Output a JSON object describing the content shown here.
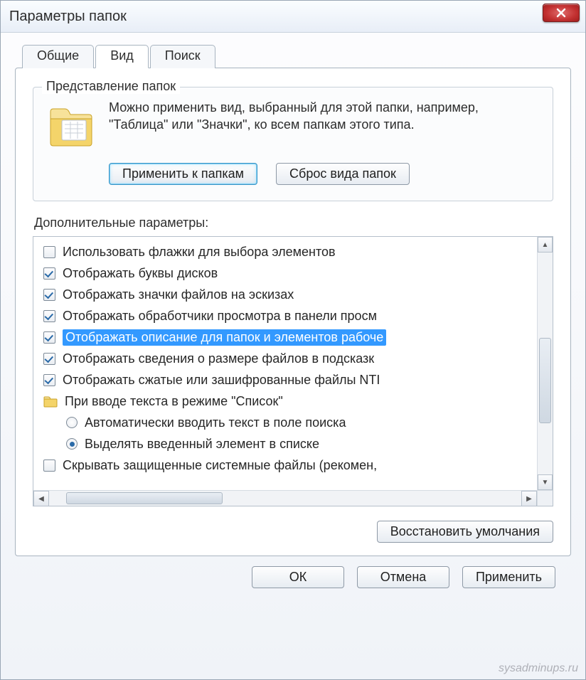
{
  "window": {
    "title": "Параметры папок"
  },
  "tabs": {
    "general": "Общие",
    "view": "Вид",
    "search": "Поиск"
  },
  "fieldset": {
    "legend": "Представление папок",
    "text": "Можно применить вид, выбранный для этой папки, например, \"Таблица\" или \"Значки\", ко всем папкам этого типа.",
    "apply_btn": "Применить к папкам",
    "reset_btn": "Сброс вида папок"
  },
  "adv_label": "Дополнительные параметры:",
  "items": [
    {
      "type": "checkbox",
      "checked": false,
      "label": "Использовать флажки для выбора элементов"
    },
    {
      "type": "checkbox",
      "checked": true,
      "label": "Отображать буквы дисков"
    },
    {
      "type": "checkbox",
      "checked": true,
      "label": "Отображать значки файлов на эскизах"
    },
    {
      "type": "checkbox",
      "checked": true,
      "label": "Отображать обработчики просмотра в панели просм"
    },
    {
      "type": "checkbox",
      "checked": true,
      "label": "Отображать описание для папок и элементов рабоче",
      "selected": true
    },
    {
      "type": "checkbox",
      "checked": true,
      "label": "Отображать сведения о размере файлов в подсказк"
    },
    {
      "type": "checkbox",
      "checked": true,
      "label": "Отображать сжатые или зашифрованные файлы NTI"
    },
    {
      "type": "folder",
      "label": "При вводе текста в режиме \"Список\""
    },
    {
      "type": "radio",
      "checked": false,
      "indent": true,
      "label": "Автоматически вводить текст в поле поиска"
    },
    {
      "type": "radio",
      "checked": true,
      "indent": true,
      "label": "Выделять введенный элемент в списке"
    },
    {
      "type": "checkbox",
      "checked": false,
      "label": "Скрывать защищенные системные файлы (рекомен,"
    }
  ],
  "restore_btn": "Восстановить умолчания",
  "buttons": {
    "ok": "ОК",
    "cancel": "Отмена",
    "apply": "Применить"
  },
  "watermark": "sysadminups.ru"
}
